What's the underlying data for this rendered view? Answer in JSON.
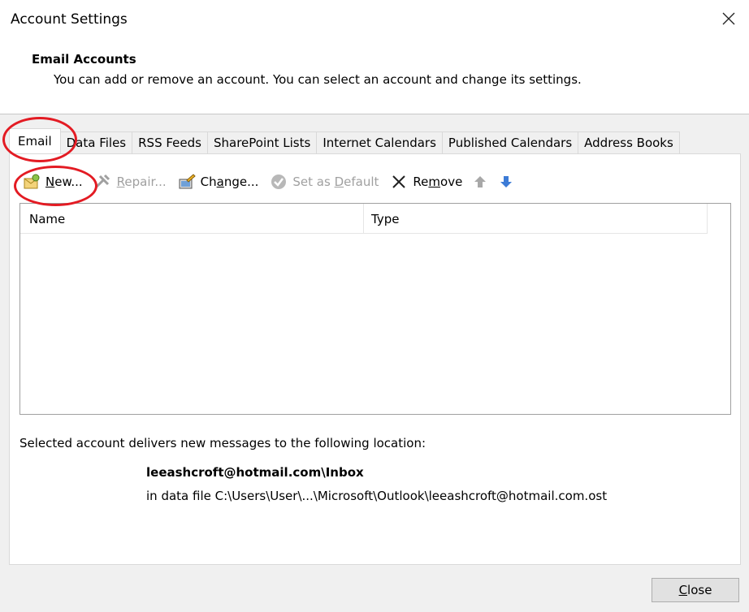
{
  "window": {
    "title": "Account Settings"
  },
  "header": {
    "title": "Email Accounts",
    "description": "You can add or remove an account. You can select an account and change its settings."
  },
  "tabs": [
    {
      "label": "Email"
    },
    {
      "label": "Data Files"
    },
    {
      "label": "RSS Feeds"
    },
    {
      "label": "SharePoint Lists"
    },
    {
      "label": "Internet Calendars"
    },
    {
      "label": "Published Calendars"
    },
    {
      "label": "Address Books"
    }
  ],
  "toolbar": {
    "new": {
      "pre": "",
      "key": "N",
      "post": "ew..."
    },
    "repair": {
      "pre": "",
      "key": "R",
      "post": "epair..."
    },
    "change": {
      "pre": "Ch",
      "key": "a",
      "post": "nge..."
    },
    "set_default": {
      "pre": "Set as ",
      "key": "D",
      "post": "efault"
    },
    "remove": {
      "pre": "Re",
      "key": "m",
      "post": "ove"
    },
    "icons": [
      "new-account-icon",
      "repair-icon",
      "change-icon",
      "set-default-icon",
      "remove-icon",
      "move-up-icon",
      "move-down-icon"
    ],
    "arrow_color": "#3c7bd6"
  },
  "list": {
    "columns": [
      "Name",
      "Type"
    ],
    "rows": []
  },
  "delivery": {
    "label": "Selected account delivers new messages to the following location:",
    "folder": "leeashcroft@hotmail.com\\Inbox",
    "file": "in data file C:\\Users\\User\\...\\Microsoft\\Outlook\\leeashcroft@hotmail.com.ost"
  },
  "footer": {
    "close": {
      "pre": "",
      "key": "C",
      "post": "lose"
    }
  },
  "annotation_color": "#e31b23"
}
